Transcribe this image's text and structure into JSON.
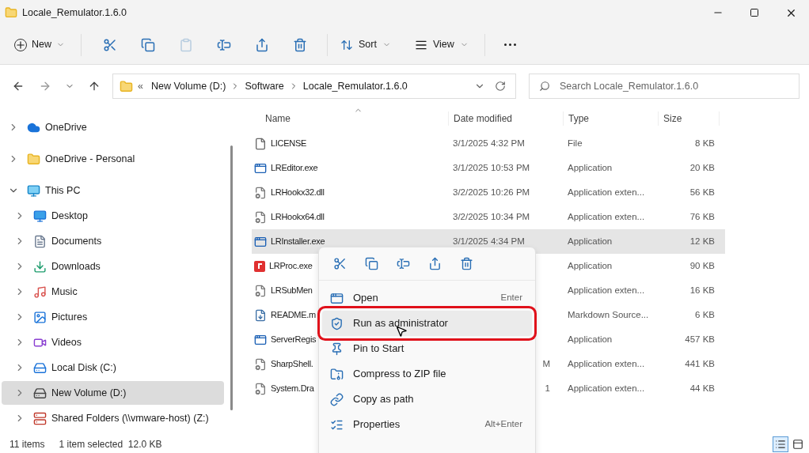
{
  "window": {
    "title": "Locale_Remulator.1.6.0"
  },
  "toolbar": {
    "new": "New",
    "actions": [
      {
        "kind": "cut",
        "disabled": false
      },
      {
        "kind": "copy",
        "disabled": false
      },
      {
        "kind": "paste",
        "disabled": true
      },
      {
        "kind": "rename",
        "disabled": false
      },
      {
        "kind": "share",
        "disabled": false
      },
      {
        "kind": "delete",
        "disabled": false
      }
    ],
    "sort": "Sort",
    "view": "View"
  },
  "address": {
    "overflow": "«",
    "crumbs": [
      "New Volume (D:)",
      "Software",
      "Locale_Remulator.1.6.0"
    ],
    "search_placeholder": "Search Locale_Remulator.1.6.0"
  },
  "sidebar": {
    "items": [
      {
        "label": "OneDrive",
        "expanded": false,
        "selected": false
      },
      {
        "label": "OneDrive - Personal",
        "expanded": false,
        "selected": false
      },
      {
        "label": "This PC",
        "expanded": true,
        "selected": false,
        "children": [
          {
            "label": "Desktop",
            "expanded": false,
            "selected": false
          },
          {
            "label": "Documents",
            "expanded": false,
            "selected": false
          },
          {
            "label": "Downloads",
            "expanded": false,
            "selected": false
          },
          {
            "label": "Music",
            "expanded": false,
            "selected": false
          },
          {
            "label": "Pictures",
            "expanded": false,
            "selected": false
          },
          {
            "label": "Videos",
            "expanded": false,
            "selected": false
          },
          {
            "label": "Local Disk (C:)",
            "expanded": false,
            "selected": false
          },
          {
            "label": "New Volume (D:)",
            "expanded": false,
            "selected": true
          },
          {
            "label": "Shared Folders (\\\\vmware-host) (Z:)",
            "expanded": false,
            "selected": false
          }
        ]
      }
    ]
  },
  "table": {
    "columns": [
      "Name",
      "Date modified",
      "Type",
      "Size"
    ],
    "rows": [
      {
        "kind": "full",
        "name": "LICENSE",
        "date": "3/1/2025 4:32 PM",
        "type": "File",
        "size": "8 KB",
        "selected": false
      },
      {
        "kind": "full",
        "name": "LREditor.exe",
        "date": "3/1/2025 10:53 PM",
        "type": "Application",
        "size": "20 KB",
        "selected": false
      },
      {
        "kind": "full",
        "name": "LRHookx32.dll",
        "date": "3/2/2025 10:26 PM",
        "type": "Application exten...",
        "size": "56 KB",
        "selected": false
      },
      {
        "kind": "full",
        "name": "LRHookx64.dll",
        "date": "3/2/2025 10:34 PM",
        "type": "Application exten...",
        "size": "76 KB",
        "selected": false
      },
      {
        "kind": "full",
        "name": "LRInstaller.exe",
        "date": "3/1/2025 4:34 PM",
        "type": "Application",
        "size": "12 KB",
        "selected": true
      },
      {
        "kind": "covered",
        "name": "LRProc.exe",
        "type": "Application",
        "size": "90 KB",
        "selected": false
      },
      {
        "kind": "covered",
        "name": "LRSubMen",
        "type": "Application exten...",
        "size": "16 KB",
        "selected": false
      },
      {
        "kind": "covered",
        "name": "README.m",
        "type": "Markdown Source...",
        "size": "6 KB",
        "selected": false
      },
      {
        "kind": "covered",
        "name": "ServerRegis",
        "type": "Application",
        "size": "457 KB",
        "selected": false
      },
      {
        "kind": "covered",
        "name": "SharpShell.",
        "date": "M",
        "type": "Application exten...",
        "size": "441 KB",
        "selected": false
      },
      {
        "kind": "covered",
        "name": "System.Dra",
        "date": "1",
        "type": "Application exten...",
        "size": "44 KB",
        "selected": false
      }
    ]
  },
  "context_menu": {
    "items": [
      {
        "label": "Open",
        "shortcut": "Enter",
        "highlighted": false
      },
      {
        "label": "Run as administrator",
        "highlighted": true
      },
      {
        "label": "Pin to Start",
        "highlighted": false
      },
      {
        "label": "Compress to ZIP file",
        "highlighted": false
      },
      {
        "label": "Copy as path",
        "highlighted": false
      },
      {
        "label": "Properties",
        "shortcut": "Alt+Enter",
        "highlighted": false
      }
    ]
  },
  "status_bar": {
    "count": "11 items",
    "selection": "1 item selected  12.0 KB",
    "view_buttons": [
      {
        "selected": true
      },
      {
        "selected": false
      }
    ]
  }
}
